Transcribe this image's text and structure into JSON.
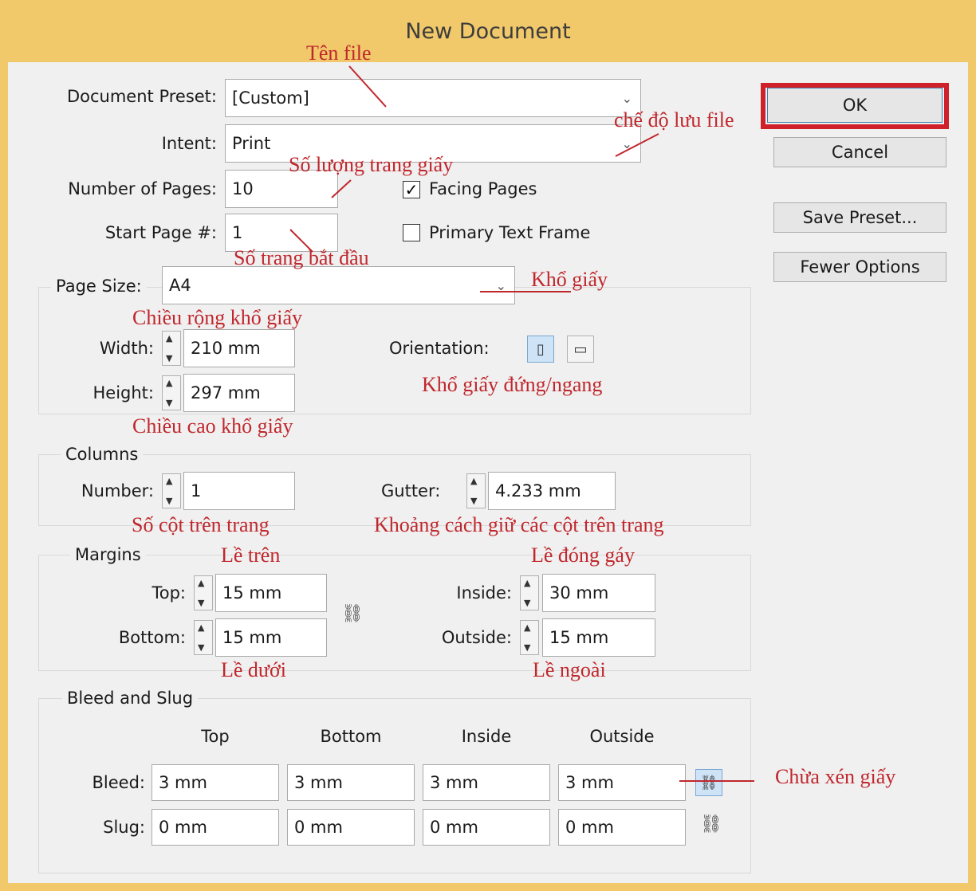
{
  "window": {
    "title": "New Document"
  },
  "fields": {
    "document_preset": {
      "label": "Document Preset:",
      "value": "[Custom]"
    },
    "intent": {
      "label": "Intent:",
      "value": "Print"
    },
    "number_of_pages": {
      "label": "Number of Pages:",
      "value": "10"
    },
    "start_page": {
      "label": "Start Page #:",
      "value": "1"
    },
    "facing_pages": {
      "label": "Facing Pages",
      "checked": true
    },
    "primary_text_frame": {
      "label": "Primary Text Frame",
      "checked": false
    }
  },
  "buttons": {
    "ok": "OK",
    "cancel": "Cancel",
    "save_preset": "Save Preset...",
    "fewer_options": "Fewer Options"
  },
  "page_size": {
    "label": "Page Size:",
    "value": "A4",
    "width_label": "Width:",
    "width": "210 mm",
    "height_label": "Height:",
    "height": "297 mm",
    "orientation_label": "Orientation:"
  },
  "columns": {
    "title": "Columns",
    "number_label": "Number:",
    "number": "1",
    "gutter_label": "Gutter:",
    "gutter": "4.233 mm"
  },
  "margins": {
    "title": "Margins",
    "top_label": "Top:",
    "top": "15 mm",
    "bottom_label": "Bottom:",
    "bottom": "15 mm",
    "inside_label": "Inside:",
    "inside": "30 mm",
    "outside_label": "Outside:",
    "outside": "15 mm"
  },
  "bleed_slug": {
    "title": "Bleed and Slug",
    "headers": [
      "Top",
      "Bottom",
      "Inside",
      "Outside"
    ],
    "bleed_label": "Bleed:",
    "bleed": [
      "3 mm",
      "3 mm",
      "3 mm",
      "3 mm"
    ],
    "slug_label": "Slug:",
    "slug": [
      "0 mm",
      "0 mm",
      "0 mm",
      "0 mm"
    ]
  },
  "annotations": {
    "file_name": "Tên file",
    "save_mode": "chế độ lưu file",
    "page_count": "Số lượng trang giấy",
    "start_page": "Số trang bắt đầu",
    "paper_size": "Khổ giấy",
    "paper_width": "Chiều rộng khổ giấy",
    "orientation": "Khổ giấy đứng/ngang",
    "paper_height": "Chiều cao khổ giấy",
    "column_count": "Số cột trên trang",
    "gutter": "Khoảng cách giữ các cột trên trang",
    "top_margin": "Lề trên",
    "binding_margin": "Lề đóng gáy",
    "bottom_margin": "Lề dưới",
    "outside_margin": "Lề ngoài",
    "bleed": "Chừa xén giấy"
  },
  "colors": {
    "title_bar": "#f1c86a",
    "dialog_bg": "#f0f0f0",
    "annotation": "#c0272d",
    "highlight": "#d0202a"
  }
}
